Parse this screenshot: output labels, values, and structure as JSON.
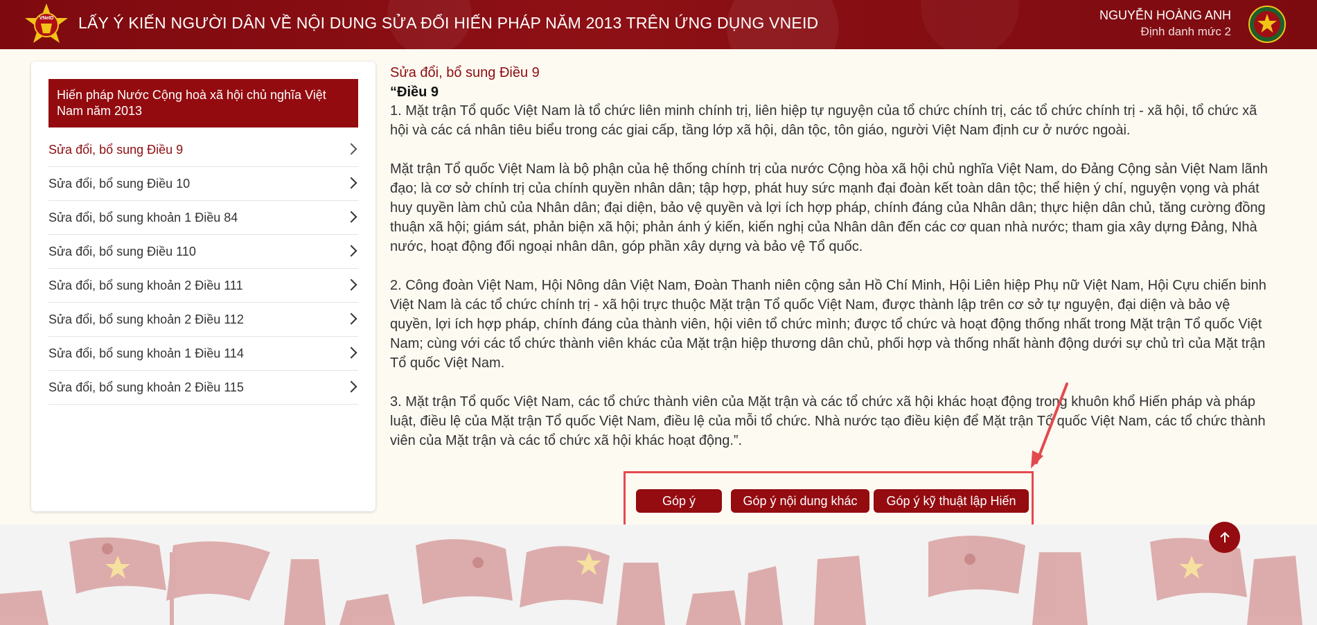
{
  "header": {
    "title": "LẤY Ý KIẾN NGƯỜI DÂN VỀ NỘI DUNG SỬA ĐỔI HIẾN PHÁP NĂM 2013 TRÊN ỨNG DỤNG VNEID",
    "logo_text": "VNeID",
    "user_name": "NGUYỄN HOÀNG ANH",
    "user_level": "Định danh mức 2"
  },
  "sidebar": {
    "title": "Hiến pháp Nước Cộng hoà xã hội chủ nghĩa Việt Nam năm 2013",
    "items": [
      {
        "label": "Sửa đổi, bổ sung Điều 9",
        "active": true
      },
      {
        "label": "Sửa đổi, bổ sung Điều 10"
      },
      {
        "label": "Sửa đổi, bổ sung khoản 1 Điều 84"
      },
      {
        "label": "Sửa đổi, bổ sung Điều 110"
      },
      {
        "label": "Sửa đổi, bổ sung khoản 2 Điều 111"
      },
      {
        "label": "Sửa đổi, bổ sung khoản 2 Điều 112"
      },
      {
        "label": "Sửa đổi, bổ sung khoản 1 Điều 114"
      },
      {
        "label": "Sửa đổi, bổ sung khoản 2 Điều 115"
      }
    ]
  },
  "content": {
    "section_title": "Sửa đổi, bổ sung Điều 9",
    "article_title": "“Điều 9",
    "paragraphs": [
      "1. Mặt trận Tổ quốc Việt Nam là tổ chức liên minh chính trị, liên hiệp tự nguyện của tổ chức chính trị, các tổ chức chính trị - xã hội, tổ chức xã hội và các cá nhân tiêu biểu trong các giai cấp, tầng lớp xã hội, dân tộc, tôn giáo, người Việt Nam định cư ở nước ngoài.",
      "Mặt trận Tổ quốc Việt Nam là bộ phận của hệ thống chính trị của nước Cộng hòa xã hội chủ nghĩa Việt Nam, do Đảng Cộng sản Việt Nam lãnh đạo; là cơ sở chính trị của chính quyền nhân dân; tập hợp, phát huy sức mạnh đại đoàn kết toàn dân tộc; thể hiện ý chí, nguyện vọng và phát huy quyền làm chủ của Nhân dân; đại diện, bảo vệ quyền và lợi ích hợp pháp, chính đáng của Nhân dân; thực hiện dân chủ, tăng cường đồng thuận xã hội; giám sát, phản biện xã hội; phản ánh ý kiến, kiến nghị của Nhân dân đến các cơ quan nhà nước; tham gia xây dựng Đảng, Nhà nước, hoạt động đối ngoại nhân dân, góp phần xây dựng và bảo vệ Tổ quốc.",
      "2. Công đoàn Việt Nam, Hội Nông dân Việt Nam, Đoàn Thanh niên cộng sản Hồ Chí Minh, Hội Liên hiệp Phụ nữ Việt Nam, Hội Cựu chiến binh Việt Nam là các tổ chức chính trị - xã hội trực thuộc Mặt trận Tổ quốc Việt Nam, được thành lập trên cơ sở tự nguyện, đại diện và bảo vệ quyền, lợi ích hợp pháp, chính đáng của thành viên, hội viên tổ chức mình; được tổ chức và hoạt động thống nhất trong Mặt trận Tổ quốc Việt Nam; cùng với các tổ chức thành viên khác của Mặt trận hiệp thương dân chủ, phối hợp và thống nhất hành động dưới sự chủ trì của Mặt trận Tổ quốc Việt Nam.",
      "3. Mặt trận Tổ quốc Việt Nam, các tổ chức thành viên của Mặt trận và các tổ chức xã hội khác hoạt động trong khuôn khổ Hiến pháp và pháp luật, điều lệ của Mặt trận Tổ quốc Việt Nam, điều lệ của mỗi tổ chức. Nhà nước tạo điều kiện để Mặt trận Tổ quốc Việt Nam, các tổ chức thành viên của Mặt trận và các tổ chức xã hội khác hoạt động.”."
    ]
  },
  "actions": {
    "comment": "Góp ý",
    "other_content": "Góp ý nội dung khác",
    "technique": "Góp ý kỹ thuật lập Hiến"
  },
  "colors": {
    "brand": "#940b10",
    "header_bg": "#830c11",
    "annotation": "#e34a4d"
  }
}
